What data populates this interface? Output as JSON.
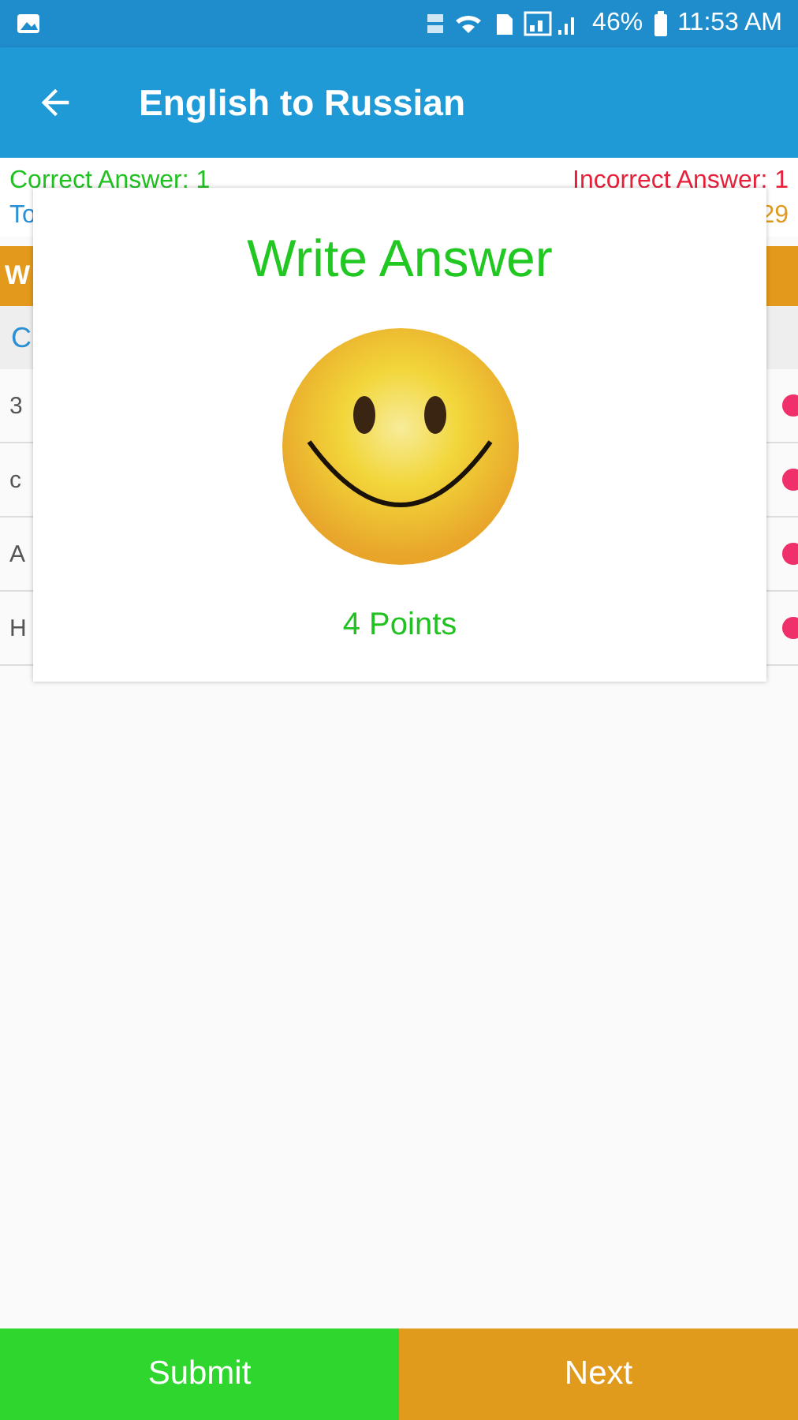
{
  "status_bar": {
    "battery": "46%",
    "time": "11:53 AM"
  },
  "app_bar": {
    "title": "English to Russian"
  },
  "score": {
    "correct": "Correct Answer: 1",
    "incorrect": "Incorrect Answer: 1",
    "total": "To",
    "points": "29"
  },
  "section_bar": {
    "label": "W"
  },
  "list_header": {
    "label": "C"
  },
  "rows": [
    {
      "label": "3"
    },
    {
      "label": "c"
    },
    {
      "label": "A"
    },
    {
      "label": "H"
    }
  ],
  "dialog": {
    "title": "Write Answer",
    "points": "4 Points"
  },
  "buttons": [
    {
      "label": "Submit",
      "kind": "submit"
    },
    {
      "label": "Next",
      "kind": "next"
    }
  ]
}
